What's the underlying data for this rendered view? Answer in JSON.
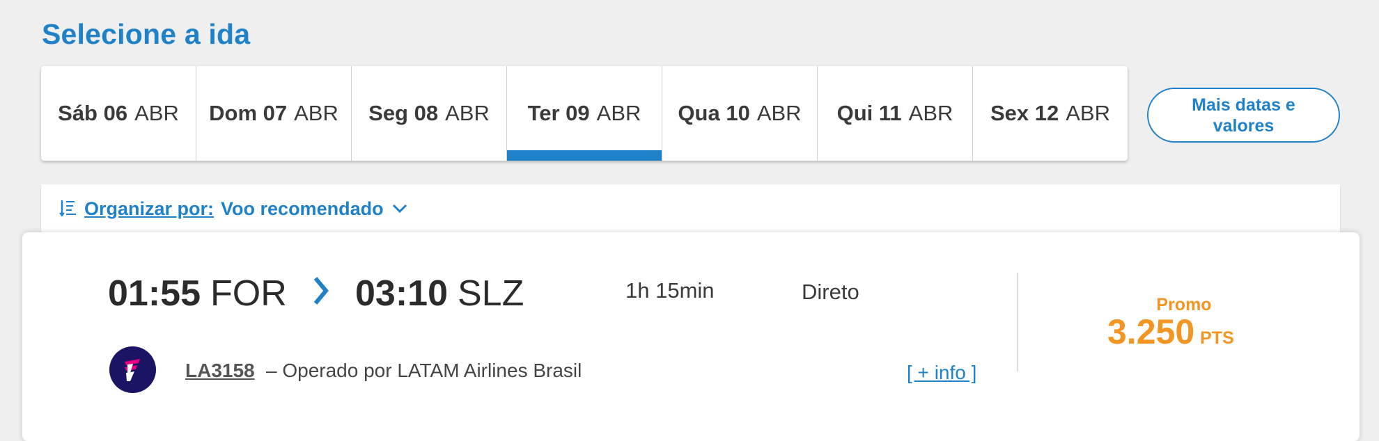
{
  "header": {
    "title": "Selecione a ida"
  },
  "dates": [
    {
      "weekday": "Sáb 06",
      "month": "ABR",
      "active": false
    },
    {
      "weekday": "Dom 07",
      "month": "ABR",
      "active": false
    },
    {
      "weekday": "Seg 08",
      "month": "ABR",
      "active": false
    },
    {
      "weekday": "Ter 09",
      "month": "ABR",
      "active": true
    },
    {
      "weekday": "Qua 10",
      "month": "ABR",
      "active": false
    },
    {
      "weekday": "Qui 11",
      "month": "ABR",
      "active": false
    },
    {
      "weekday": "Sex 12",
      "month": "ABR",
      "active": false
    }
  ],
  "more_dates_label": "Mais datas e valores",
  "sort": {
    "label": "Organizar por:",
    "value": "Voo recomendado",
    "icon": "sort-icon",
    "dropdown_icon": "chevron-down-icon"
  },
  "flight": {
    "departure_time": "01:55",
    "departure_code": "FOR",
    "arrival_time": "03:10",
    "arrival_code": "SLZ",
    "duration": "1h 15min",
    "stops": "Direto",
    "promo_label": "Promo",
    "price": "3.250",
    "price_unit": "PTS",
    "flight_number": "LA3158",
    "operated_by": "– Operado por LATAM Airlines Brasil",
    "info_link": "[ + info ]",
    "airline_icon": "latam-logo-icon"
  },
  "colors": {
    "accent": "#1f82c8",
    "price": "#f39523",
    "airline_logo": "#1b1464"
  }
}
